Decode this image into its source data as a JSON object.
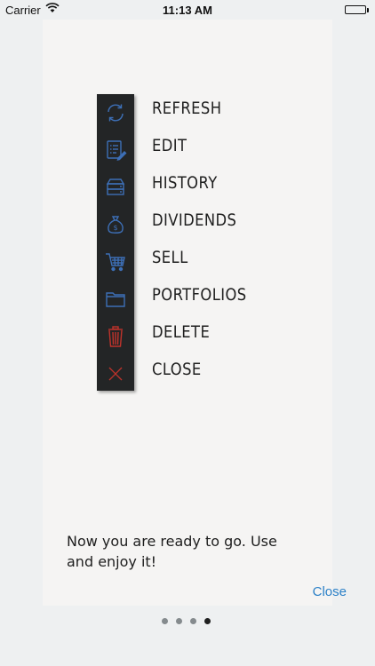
{
  "status_bar": {
    "carrier": "Carrier",
    "time": "11:13 AM"
  },
  "menu": {
    "items": [
      {
        "label": "REFRESH",
        "icon": "refresh-icon",
        "color": "#3d6fb6"
      },
      {
        "label": "EDIT",
        "icon": "edit-list-icon",
        "color": "#3d6fb6"
      },
      {
        "label": "HISTORY",
        "icon": "history-drawer-icon",
        "color": "#3d6fb6"
      },
      {
        "label": "DIVIDENDS",
        "icon": "money-bag-icon",
        "color": "#3d6fb6"
      },
      {
        "label": "SELL",
        "icon": "cart-icon",
        "color": "#3d6fb6"
      },
      {
        "label": "PORTFOLIOS",
        "icon": "folder-icon",
        "color": "#3d6fb6"
      },
      {
        "label": "DELETE",
        "icon": "trash-icon",
        "color": "#c0332b"
      },
      {
        "label": "CLOSE",
        "icon": "close-x-icon",
        "color": "#c0332b"
      }
    ]
  },
  "instruction": "Now you are ready to go. Use and enjoy it!",
  "close_label": "Close",
  "pager": {
    "total": 4,
    "current": 4
  },
  "colors": {
    "accent": "#2b80c7",
    "icon_blue": "#3d6fb6",
    "icon_red": "#c0332b",
    "toolbar_bg": "#232526"
  }
}
